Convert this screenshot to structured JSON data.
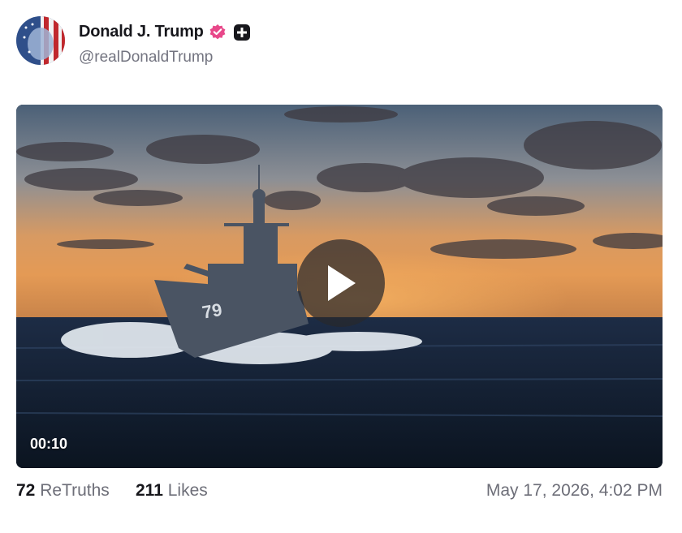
{
  "post": {
    "author": {
      "display_name": "Donald J. Trump",
      "handle": "@realDonaldTrump",
      "verified_badge_icon": "verified-badge-icon",
      "plus_badge_icon": "plus-badge-icon",
      "verified_color": "#e8488a"
    },
    "media": {
      "type": "video",
      "duration": "00:10",
      "play_icon": "play-icon",
      "hull_number": "79"
    },
    "stats": {
      "retruths_count": "72",
      "retruths_label": "ReTruths",
      "likes_count": "211",
      "likes_label": "Likes"
    },
    "timestamp": "May 17, 2026, 4:02 PM"
  }
}
